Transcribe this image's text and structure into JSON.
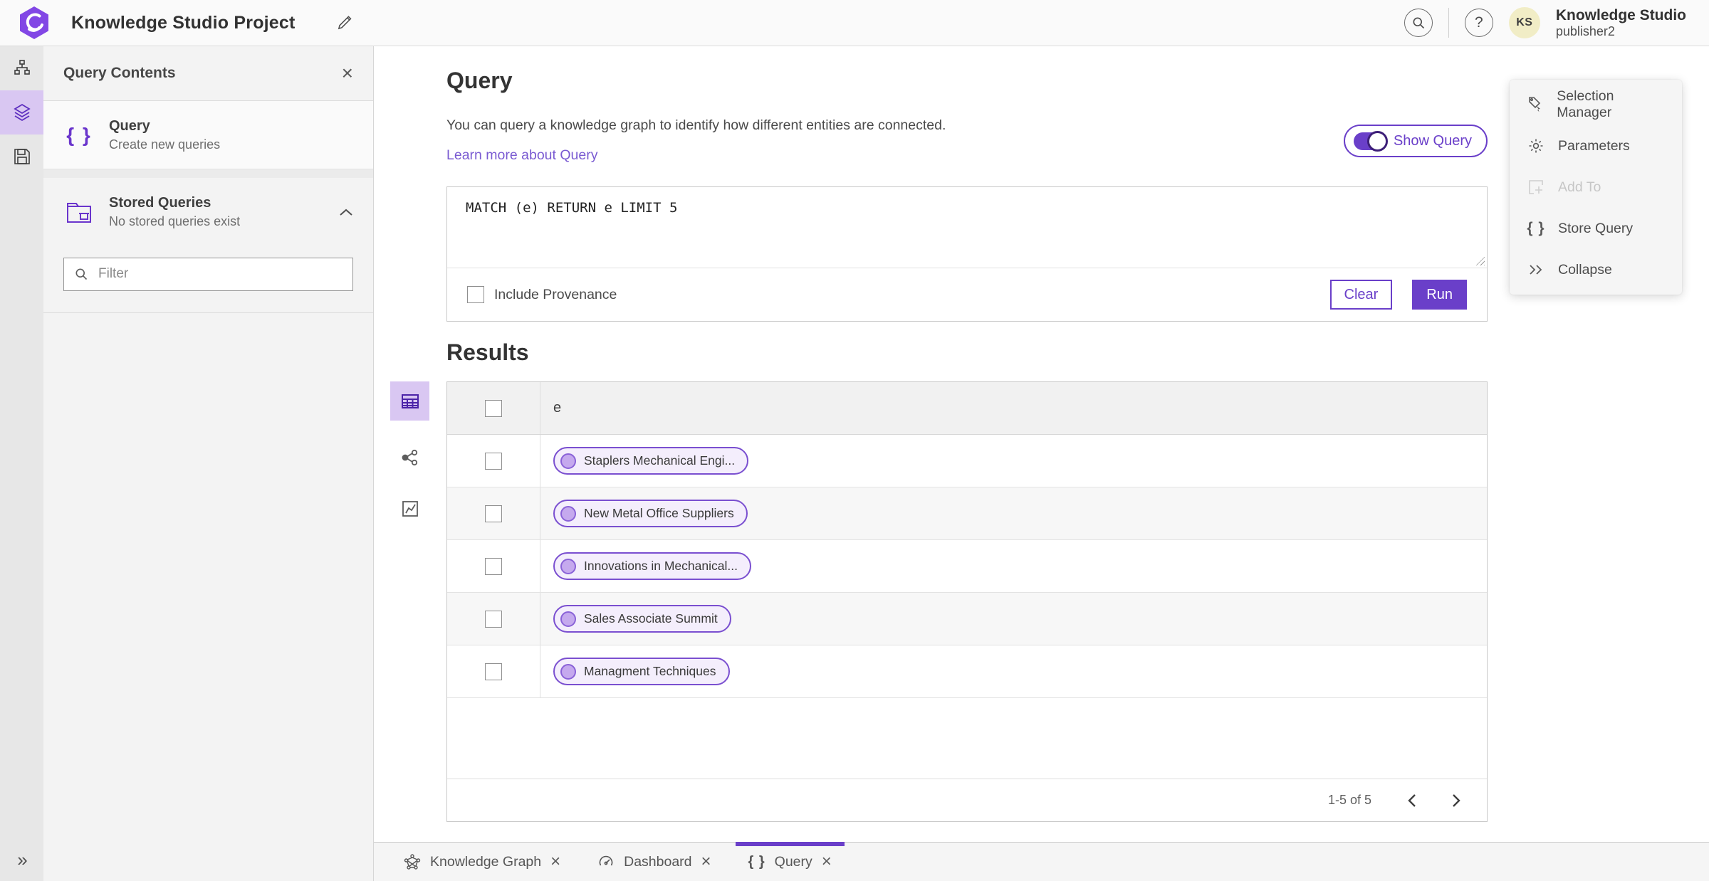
{
  "header": {
    "title": "Knowledge Studio Project",
    "user": {
      "initials": "KS",
      "org": "Knowledge Studio",
      "name": "publisher2"
    }
  },
  "icons": {
    "question": "?",
    "close": "×",
    "braces": "{ }",
    "chevrons_right": "»"
  },
  "contents_panel": {
    "title": "Query Contents",
    "query_item": {
      "title": "Query",
      "subtitle": "Create new queries"
    },
    "stored_item": {
      "title": "Stored Queries",
      "subtitle": "No stored queries exist"
    },
    "filter_placeholder": "Filter"
  },
  "query_section": {
    "title": "Query",
    "description": "You can query a knowledge graph to identify how different entities are connected.",
    "learn_more": "Learn more about Query",
    "show_query_label": "Show Query",
    "query_text": "MATCH (e) RETURN e LIMIT 5",
    "include_provenance_label": "Include Provenance",
    "clear_label": "Clear",
    "run_label": "Run"
  },
  "results": {
    "title": "Results",
    "column_header": "e",
    "rows": [
      {
        "label": "Staplers Mechanical Engi..."
      },
      {
        "label": "New Metal Office Suppliers"
      },
      {
        "label": "Innovations in Mechanical..."
      },
      {
        "label": "Sales Associate Summit"
      },
      {
        "label": "Managment Techniques"
      }
    ],
    "pagination": {
      "range": "1-5 of 5"
    }
  },
  "tools_menu": {
    "items": [
      {
        "label": "Selection Manager",
        "disabled": false
      },
      {
        "label": "Parameters",
        "disabled": false
      },
      {
        "label": "Add To",
        "disabled": true
      },
      {
        "label": "Store Query",
        "disabled": false
      },
      {
        "label": "Collapse",
        "disabled": false
      }
    ]
  },
  "bottom_tabs": [
    {
      "label": "Knowledge Graph",
      "active": false
    },
    {
      "label": "Dashboard",
      "active": false
    },
    {
      "label": "Query",
      "active": true
    }
  ],
  "colors": {
    "accent_purple": "#6a3fc9",
    "selected_light_purple": "#d9c7f2",
    "chip_background": "#f4eefc",
    "avatar_background": "#f1edc6"
  }
}
